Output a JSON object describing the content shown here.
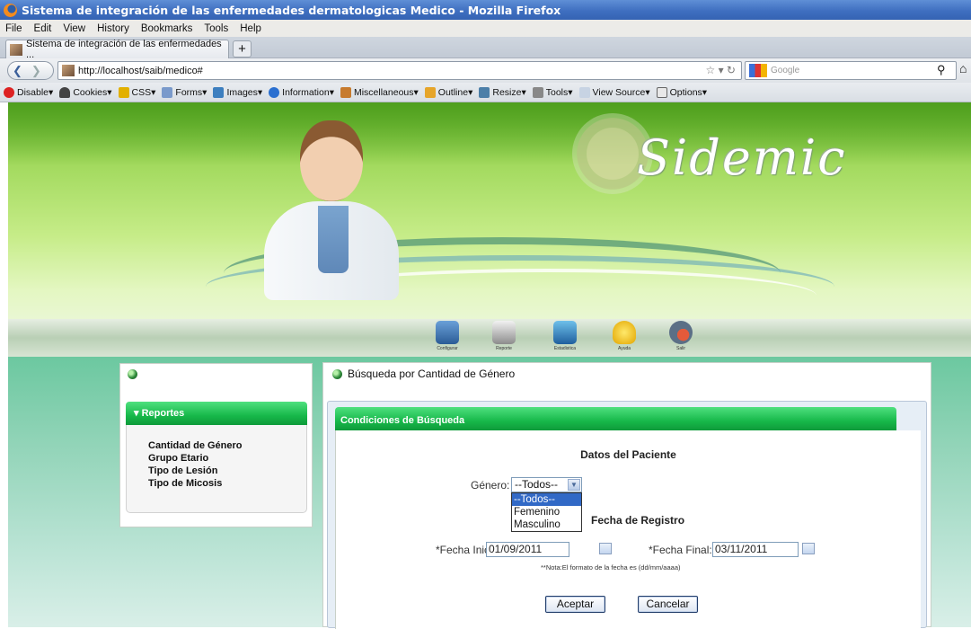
{
  "window": {
    "title": "Sistema de integración de las enfermedades dermatologicas Medico - Mozilla Firefox"
  },
  "menu": [
    "File",
    "Edit",
    "View",
    "History",
    "Bookmarks",
    "Tools",
    "Help"
  ],
  "tab": {
    "label": "Sistema de integración de las enfermedades ...",
    "new_tab": "+"
  },
  "nav": {
    "url": "http://localhost/saib/medico#",
    "search_placeholder": "Google"
  },
  "devtoolbar": [
    "Disable",
    "Cookies",
    "CSS",
    "Forms",
    "Images",
    "Information",
    "Miscellaneous",
    "Outline",
    "Resize",
    "Tools",
    "View Source",
    "Options"
  ],
  "site": {
    "brand": "Sidemic",
    "nav_icons": [
      "Configurar",
      "Reporte",
      "Estadistica",
      "Ayuda",
      "Salir"
    ]
  },
  "sidebar": {
    "section_title": "Reportes",
    "items": [
      "Cantidad de Género",
      "Grupo Etario",
      "Tipo de Lesión",
      "Tipo de Micosis"
    ]
  },
  "main": {
    "title": "Búsqueda por Cantidad de Género",
    "tab_label": "Condiciones de Búsqueda",
    "datos_title": "Datos del Paciente",
    "genero_label": "Género:",
    "genero_value": "--Todos--",
    "genero_options": [
      "--Todos--",
      "Femenino",
      "Masculino"
    ],
    "fecha_registro_title": "Fecha de Registro",
    "fecha_inicial_label": "*Fecha Inicial:",
    "fecha_inicial_value": "01/09/2011",
    "fecha_final_label": "*Fecha Final:",
    "fecha_final_value": "03/11/2011",
    "nota": "**Nota:El formato de la fecha es (dd/mm/aaaa)",
    "accept": "Aceptar",
    "cancel": "Cancelar"
  },
  "colors": {
    "accent_green": "#17b84a",
    "selection_blue": "#3169c6",
    "titlebar_blue": "#3f6fc0"
  }
}
